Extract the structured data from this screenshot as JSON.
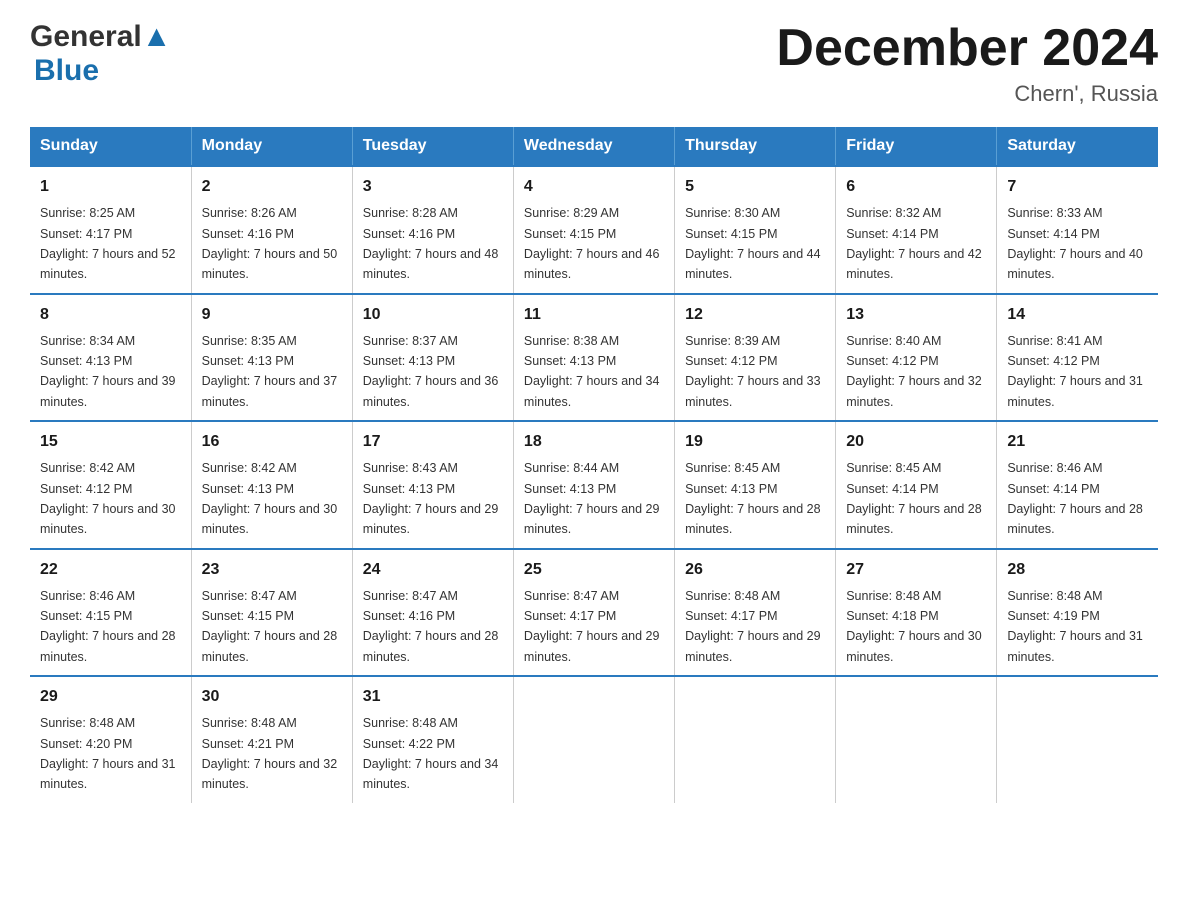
{
  "header": {
    "logo_general": "General",
    "logo_blue": "Blue",
    "title": "December 2024",
    "subtitle": "Chern', Russia"
  },
  "days_of_week": [
    "Sunday",
    "Monday",
    "Tuesday",
    "Wednesday",
    "Thursday",
    "Friday",
    "Saturday"
  ],
  "weeks": [
    [
      {
        "day": "1",
        "sunrise": "8:25 AM",
        "sunset": "4:17 PM",
        "daylight": "7 hours and 52 minutes."
      },
      {
        "day": "2",
        "sunrise": "8:26 AM",
        "sunset": "4:16 PM",
        "daylight": "7 hours and 50 minutes."
      },
      {
        "day": "3",
        "sunrise": "8:28 AM",
        "sunset": "4:16 PM",
        "daylight": "7 hours and 48 minutes."
      },
      {
        "day": "4",
        "sunrise": "8:29 AM",
        "sunset": "4:15 PM",
        "daylight": "7 hours and 46 minutes."
      },
      {
        "day": "5",
        "sunrise": "8:30 AM",
        "sunset": "4:15 PM",
        "daylight": "7 hours and 44 minutes."
      },
      {
        "day": "6",
        "sunrise": "8:32 AM",
        "sunset": "4:14 PM",
        "daylight": "7 hours and 42 minutes."
      },
      {
        "day": "7",
        "sunrise": "8:33 AM",
        "sunset": "4:14 PM",
        "daylight": "7 hours and 40 minutes."
      }
    ],
    [
      {
        "day": "8",
        "sunrise": "8:34 AM",
        "sunset": "4:13 PM",
        "daylight": "7 hours and 39 minutes."
      },
      {
        "day": "9",
        "sunrise": "8:35 AM",
        "sunset": "4:13 PM",
        "daylight": "7 hours and 37 minutes."
      },
      {
        "day": "10",
        "sunrise": "8:37 AM",
        "sunset": "4:13 PM",
        "daylight": "7 hours and 36 minutes."
      },
      {
        "day": "11",
        "sunrise": "8:38 AM",
        "sunset": "4:13 PM",
        "daylight": "7 hours and 34 minutes."
      },
      {
        "day": "12",
        "sunrise": "8:39 AM",
        "sunset": "4:12 PM",
        "daylight": "7 hours and 33 minutes."
      },
      {
        "day": "13",
        "sunrise": "8:40 AM",
        "sunset": "4:12 PM",
        "daylight": "7 hours and 32 minutes."
      },
      {
        "day": "14",
        "sunrise": "8:41 AM",
        "sunset": "4:12 PM",
        "daylight": "7 hours and 31 minutes."
      }
    ],
    [
      {
        "day": "15",
        "sunrise": "8:42 AM",
        "sunset": "4:12 PM",
        "daylight": "7 hours and 30 minutes."
      },
      {
        "day": "16",
        "sunrise": "8:42 AM",
        "sunset": "4:13 PM",
        "daylight": "7 hours and 30 minutes."
      },
      {
        "day": "17",
        "sunrise": "8:43 AM",
        "sunset": "4:13 PM",
        "daylight": "7 hours and 29 minutes."
      },
      {
        "day": "18",
        "sunrise": "8:44 AM",
        "sunset": "4:13 PM",
        "daylight": "7 hours and 29 minutes."
      },
      {
        "day": "19",
        "sunrise": "8:45 AM",
        "sunset": "4:13 PM",
        "daylight": "7 hours and 28 minutes."
      },
      {
        "day": "20",
        "sunrise": "8:45 AM",
        "sunset": "4:14 PM",
        "daylight": "7 hours and 28 minutes."
      },
      {
        "day": "21",
        "sunrise": "8:46 AM",
        "sunset": "4:14 PM",
        "daylight": "7 hours and 28 minutes."
      }
    ],
    [
      {
        "day": "22",
        "sunrise": "8:46 AM",
        "sunset": "4:15 PM",
        "daylight": "7 hours and 28 minutes."
      },
      {
        "day": "23",
        "sunrise": "8:47 AM",
        "sunset": "4:15 PM",
        "daylight": "7 hours and 28 minutes."
      },
      {
        "day": "24",
        "sunrise": "8:47 AM",
        "sunset": "4:16 PM",
        "daylight": "7 hours and 28 minutes."
      },
      {
        "day": "25",
        "sunrise": "8:47 AM",
        "sunset": "4:17 PM",
        "daylight": "7 hours and 29 minutes."
      },
      {
        "day": "26",
        "sunrise": "8:48 AM",
        "sunset": "4:17 PM",
        "daylight": "7 hours and 29 minutes."
      },
      {
        "day": "27",
        "sunrise": "8:48 AM",
        "sunset": "4:18 PM",
        "daylight": "7 hours and 30 minutes."
      },
      {
        "day": "28",
        "sunrise": "8:48 AM",
        "sunset": "4:19 PM",
        "daylight": "7 hours and 31 minutes."
      }
    ],
    [
      {
        "day": "29",
        "sunrise": "8:48 AM",
        "sunset": "4:20 PM",
        "daylight": "7 hours and 31 minutes."
      },
      {
        "day": "30",
        "sunrise": "8:48 AM",
        "sunset": "4:21 PM",
        "daylight": "7 hours and 32 minutes."
      },
      {
        "day": "31",
        "sunrise": "8:48 AM",
        "sunset": "4:22 PM",
        "daylight": "7 hours and 34 minutes."
      },
      null,
      null,
      null,
      null
    ]
  ]
}
